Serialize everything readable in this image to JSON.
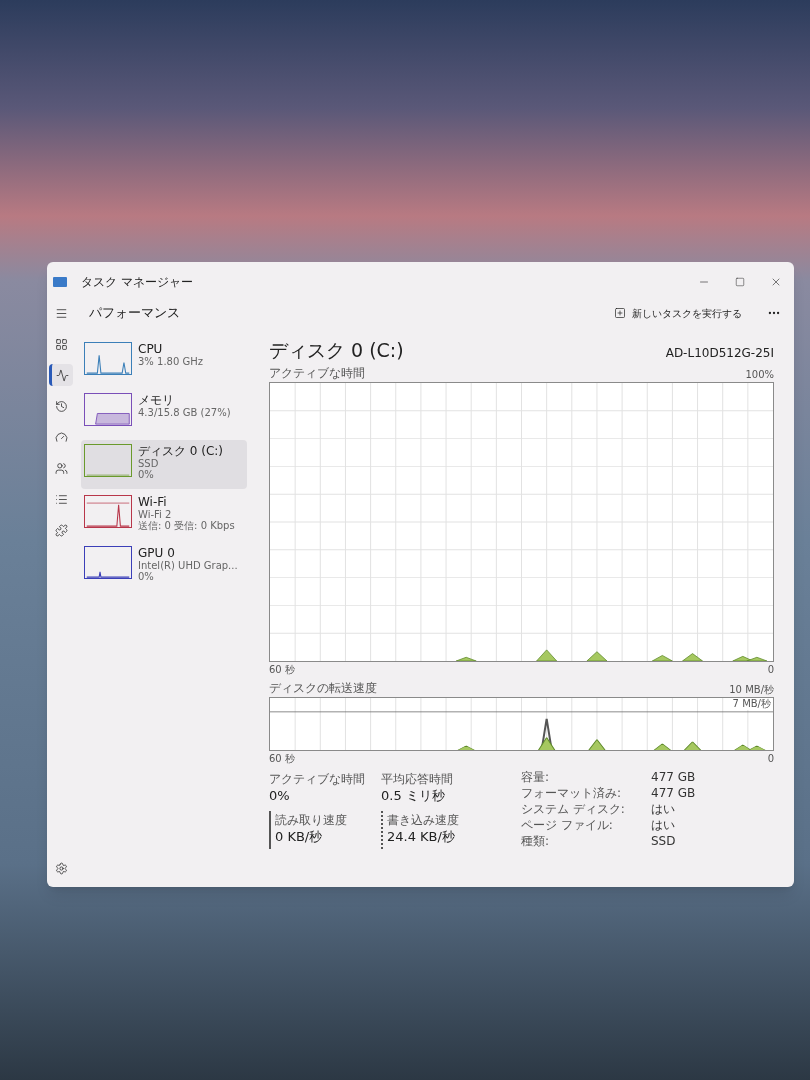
{
  "window": {
    "title": "タスク マネージャー"
  },
  "nav": [
    {
      "kind": "menu",
      "selected": false
    },
    {
      "kind": "processes",
      "selected": false
    },
    {
      "kind": "performance",
      "selected": true
    },
    {
      "kind": "history",
      "selected": false
    },
    {
      "kind": "startup",
      "selected": false
    },
    {
      "kind": "users",
      "selected": false
    },
    {
      "kind": "details",
      "selected": false
    },
    {
      "kind": "services",
      "selected": false
    },
    {
      "kind": "settings",
      "selected": false
    }
  ],
  "header": {
    "title": "パフォーマンス",
    "new_task": "新しいタスクを実行する"
  },
  "resources": [
    {
      "name": "CPU",
      "lines": [
        "3%  1.80 GHz"
      ],
      "color": "#3b7fb8",
      "kind": "spikes",
      "selected": false
    },
    {
      "name": "メモリ",
      "lines": [
        "4.3/15.8 GB (27%)"
      ],
      "color": "#7a4fb8",
      "kind": "block",
      "selected": false
    },
    {
      "name": "ディスク 0 (C:)",
      "lines": [
        "SSD",
        "0%"
      ],
      "color": "#6a9a2c",
      "kind": "flat",
      "selected": true
    },
    {
      "name": "Wi-Fi",
      "lines": [
        "Wi-Fi 2",
        "送信: 0 受信: 0 Kbps"
      ],
      "color": "#b8364a",
      "kind": "spike",
      "selected": false
    },
    {
      "name": "GPU 0",
      "lines": [
        "Intel(R) UHD Grap...",
        "0%"
      ],
      "color": "#3b3fb8",
      "kind": "small",
      "selected": false
    }
  ],
  "detail": {
    "title": "ディスク 0 (C:)",
    "model": "AD-L10D512G-25I",
    "active_chart": {
      "label": "アクティブな時間",
      "max": "100%",
      "x_start": "60 秒",
      "x_end": "0"
    },
    "transfer_chart": {
      "label": "ディスクの転送速度",
      "max": "10 MB/秒",
      "mark": "7 MB/秒",
      "x_start": "60 秒",
      "x_end": "0"
    },
    "stats": [
      {
        "label": "アクティブな時間",
        "value": "0%",
        "kind": "plain"
      },
      {
        "label": "平均応答時間",
        "value": "0.5 ミリ秒",
        "kind": "plain"
      },
      {
        "label": "読み取り速度",
        "value": "0 KB/秒",
        "kind": "read"
      },
      {
        "label": "書き込み速度",
        "value": "24.4 KB/秒",
        "kind": "write"
      }
    ],
    "properties": [
      {
        "label": "容量:",
        "value": "477 GB"
      },
      {
        "label": "フォーマット済み:",
        "value": "477 GB"
      },
      {
        "label": "システム ディスク:",
        "value": "はい"
      },
      {
        "label": "ページ ファイル:",
        "value": "はい"
      },
      {
        "label": "種類:",
        "value": "SSD"
      }
    ]
  }
}
